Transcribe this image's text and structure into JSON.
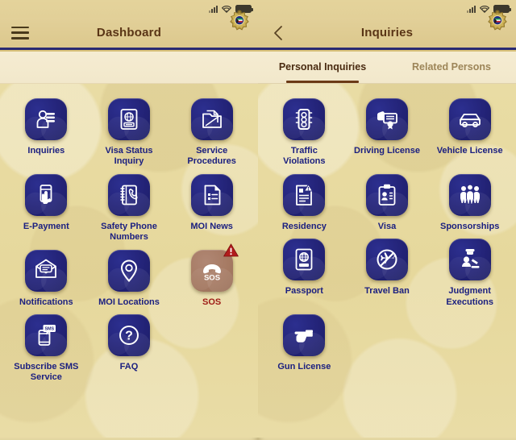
{
  "statusbar": {
    "signal_icon": "signal-bars-icon",
    "wifi_icon": "wifi-icon",
    "battery_icon": "battery-full-icon"
  },
  "left_panel": {
    "nav": {
      "menu_icon": "hamburger-menu-icon",
      "title": "Dashboard",
      "badge_icon": "moi-police-badge-icon"
    },
    "items": [
      {
        "label": "Inquiries",
        "icon": "person-documents-icon"
      },
      {
        "label": "Visa Status\nInquiry",
        "icon": "passport-globe-icon"
      },
      {
        "label": "Service\nProcedures",
        "icon": "folder-document-icon"
      },
      {
        "label": "E-Payment",
        "icon": "hand-credit-card-icon"
      },
      {
        "label": "Safety Phone\nNumbers",
        "icon": "phone-directory-icon"
      },
      {
        "label": "MOI News",
        "icon": "news-document-icon"
      },
      {
        "label": "Notifications",
        "icon": "envelope-message-icon"
      },
      {
        "label": "MOI Locations",
        "icon": "map-pin-icon"
      },
      {
        "label": "SOS",
        "icon": "sos-phone-icon",
        "variant": "sos",
        "badge": "warning-triangle-icon"
      },
      {
        "label": "Subscribe SMS\nService",
        "icon": "sms-phone-icon"
      },
      {
        "label": "FAQ",
        "icon": "question-mark-circle-icon"
      }
    ]
  },
  "right_panel": {
    "nav": {
      "back_icon": "back-chevron-icon",
      "title": "Inquiries",
      "badge_icon": "moi-police-badge-icon"
    },
    "tabs": [
      {
        "label": "Personal Inquiries",
        "active": true
      },
      {
        "label": "Related Persons",
        "active": false
      }
    ],
    "items": [
      {
        "label": "Traffic\nViolations",
        "icon": "traffic-light-icon"
      },
      {
        "label": "Driving License",
        "icon": "driving-license-card-icon"
      },
      {
        "label": "Vehicle License",
        "icon": "car-icon"
      },
      {
        "label": "Residency",
        "icon": "residency-document-icon"
      },
      {
        "label": "Visa",
        "icon": "id-card-icon"
      },
      {
        "label": "Sponsorships",
        "icon": "group-people-icon"
      },
      {
        "label": "Passport",
        "icon": "passport-book-icon"
      },
      {
        "label": "Travel Ban",
        "icon": "no-airplane-icon"
      },
      {
        "label": "Judgment\nExecutions",
        "icon": "judge-gavel-icon"
      },
      {
        "label": "Gun License",
        "icon": "handgun-icon"
      }
    ]
  },
  "colors": {
    "background": "#e7da9f",
    "tile": "#232377",
    "tile_sos": "#a67a63",
    "label": "#1c2080",
    "label_sos": "#9e1b16",
    "navbar": "#e2d099",
    "navbar_title": "#5a3516",
    "divider": "#2a2a72",
    "tab_active": "#4a2b11",
    "tab_inactive": "#9d8558",
    "tab_underline": "#6b3a16",
    "warning": "#b11c1c"
  }
}
